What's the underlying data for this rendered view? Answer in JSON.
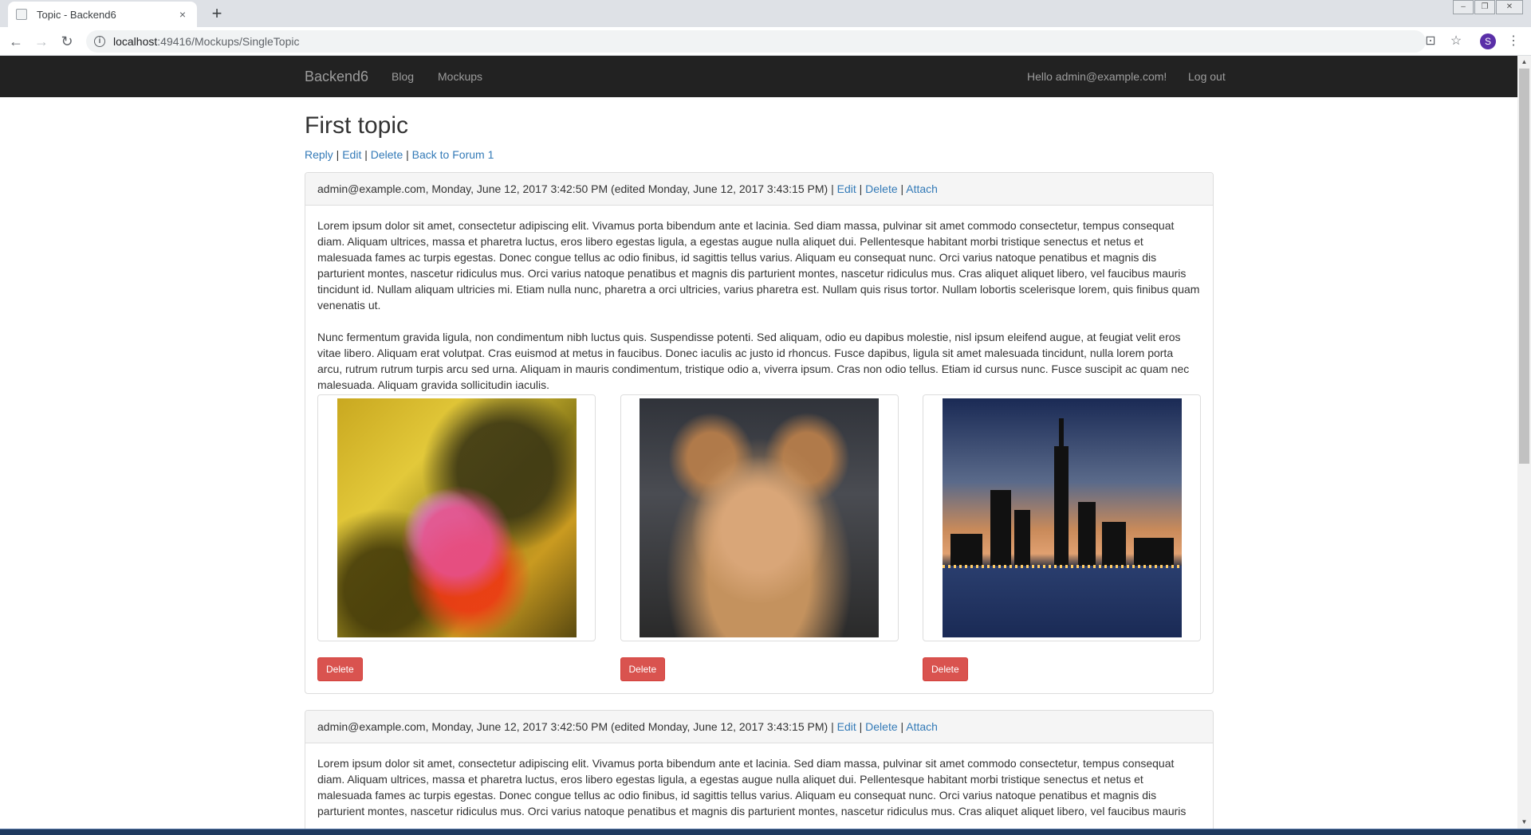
{
  "browser": {
    "tab_title": "Topic - Backend6",
    "tab_close": "×",
    "new_tab": "+",
    "url_host": "localhost",
    "url_path": ":49416/Mockups/SingleTopic",
    "profile_initial": "S"
  },
  "navbar": {
    "brand": "Backend6",
    "links": [
      "Blog",
      "Mockups"
    ],
    "greeting": "Hello admin@example.com!",
    "logout": "Log out"
  },
  "topic": {
    "title": "First topic",
    "actions": [
      "Reply",
      "Edit",
      "Delete",
      "Back to Forum 1"
    ]
  },
  "posts": [
    {
      "meta": "admin@example.com, Monday, June 12, 2017 3:42:50 PM (edited Monday, June 12, 2017 3:43:15 PM) |",
      "actions": [
        "Edit",
        "Delete",
        "Attach"
      ],
      "paragraphs": [
        "Lorem ipsum dolor sit amet, consectetur adipiscing elit. Vivamus porta bibendum ante et lacinia. Sed diam massa, pulvinar sit amet commodo consectetur, tempus consequat diam. Aliquam ultrices, massa et pharetra luctus, eros libero egestas ligula, a egestas augue nulla aliquet dui. Pellentesque habitant morbi tristique senectus et netus et malesuada fames ac turpis egestas. Donec congue tellus ac odio finibus, id sagittis tellus varius. Aliquam eu consequat nunc. Orci varius natoque penatibus et magnis dis parturient montes, nascetur ridiculus mus. Orci varius natoque penatibus et magnis dis parturient montes, nascetur ridiculus mus. Cras aliquet aliquet libero, vel faucibus mauris tincidunt id. Nullam aliquam ultricies mi. Etiam nulla nunc, pharetra a orci ultricies, varius pharetra est. Nullam quis risus tortor. Nullam lobortis scelerisque lorem, quis finibus quam venenatis ut.",
        "Nunc fermentum gravida ligula, non condimentum nibh luctus quis. Suspendisse potenti. Sed aliquam, odio eu dapibus molestie, nisl ipsum eleifend augue, at feugiat velit eros vitae libero. Aliquam erat volutpat. Cras euismod at metus in faucibus. Donec iaculis ac justo id rhoncus. Fusce dapibus, ligula sit amet malesuada tincidunt, nulla lorem porta arcu, rutrum rutrum turpis arcu sed urna. Aliquam in mauris condimentum, tristique odio a, viverra ipsum. Cras non odio tellus. Etiam id cursus nunc. Fusce suscipit ac quam nec malesuada. Aliquam gravida sollicitudin iaculis."
      ],
      "attachments": [
        {
          "image": "oil-bubbles",
          "delete_label": "Delete"
        },
        {
          "image": "cat",
          "delete_label": "Delete"
        },
        {
          "image": "city-skyline",
          "delete_label": "Delete"
        }
      ]
    },
    {
      "meta": "admin@example.com, Monday, June 12, 2017 3:42:50 PM (edited Monday, June 12, 2017 3:43:15 PM) |",
      "actions": [
        "Edit",
        "Delete",
        "Attach"
      ],
      "paragraphs": [
        "Lorem ipsum dolor sit amet, consectetur adipiscing elit. Vivamus porta bibendum ante et lacinia. Sed diam massa, pulvinar sit amet commodo consectetur, tempus consequat diam. Aliquam ultrices, massa et pharetra luctus, eros libero egestas ligula, a egestas augue nulla aliquet dui. Pellentesque habitant morbi tristique senectus et netus et malesuada fames ac turpis egestas. Donec congue tellus ac odio finibus, id sagittis tellus varius. Aliquam eu consequat nunc. Orci varius natoque penatibus et magnis dis parturient montes, nascetur ridiculus mus. Orci varius natoque penatibus et magnis dis parturient montes, nascetur ridiculus mus. Cras aliquet aliquet libero, vel faucibus mauris"
      ]
    }
  ],
  "colors": {
    "link": "#337ab7",
    "navbar_bg": "#222222",
    "danger": "#d9534f"
  }
}
